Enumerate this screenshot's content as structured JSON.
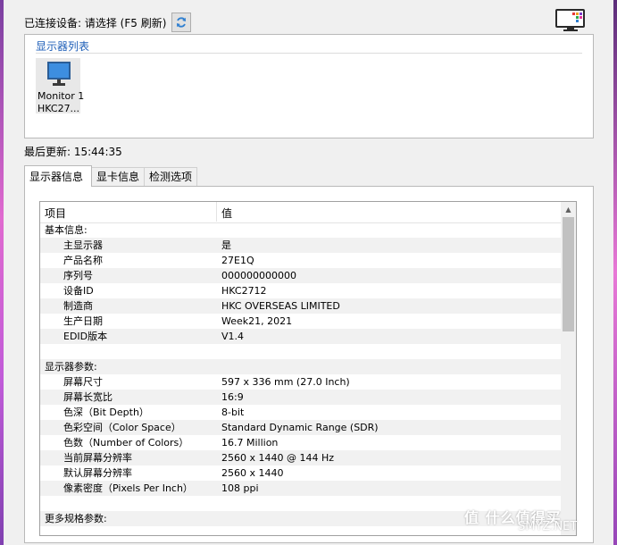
{
  "header": {
    "connected_label": "已连接设备: 请选择 (F5 刷新)"
  },
  "device_list": {
    "title": "显示器列表",
    "items": [
      {
        "name_line1": "Monitor 1",
        "name_line2": "HKC27..."
      }
    ]
  },
  "last_update": "最后更新: 15:44:35",
  "tabs": [
    {
      "label": "显示器信息",
      "active": true
    },
    {
      "label": "显卡信息",
      "active": false
    },
    {
      "label": "检测选项",
      "active": false
    }
  ],
  "table": {
    "col_item": "项目",
    "col_value": "值",
    "rows": [
      {
        "type": "section",
        "k": "基本信息:"
      },
      {
        "k": "主显示器",
        "v": "是"
      },
      {
        "k": "产品名称",
        "v": "27E1Q"
      },
      {
        "k": "序列号",
        "v": "000000000000"
      },
      {
        "k": "设备ID",
        "v": "HKC2712"
      },
      {
        "k": "制造商",
        "v": "HKC OVERSEAS LIMITED"
      },
      {
        "k": "生产日期",
        "v": "Week21, 2021"
      },
      {
        "k": "EDID版本",
        "v": "V1.4"
      },
      {
        "type": "blank"
      },
      {
        "type": "section",
        "k": "显示器参数:"
      },
      {
        "k": "屏幕尺寸",
        "v": "597 x 336 mm (27.0 Inch)"
      },
      {
        "k": "屏幕长宽比",
        "v": "16:9"
      },
      {
        "k": "色深（Bit Depth）",
        "v": "8-bit"
      },
      {
        "k": "色彩空间（Color Space）",
        "v": "Standard Dynamic Range (SDR)"
      },
      {
        "k": "色数（Number of Colors）",
        "v": "16.7 Million"
      },
      {
        "k": "当前屏幕分辨率",
        "v": "2560 x 1440 @ 144 Hz"
      },
      {
        "k": "默认屏幕分辨率",
        "v": "2560 x 1440"
      },
      {
        "k": "像素密度（Pixels Per Inch）",
        "v": "108 ppi"
      },
      {
        "type": "blank"
      },
      {
        "type": "section",
        "k": "更多规格参数:"
      }
    ]
  },
  "watermark": {
    "text": "值 什么值得买",
    "sub": "SMYZ.NET"
  },
  "colors": {
    "group_title": "#1f5fb8",
    "selection": "#e8e8e8"
  }
}
